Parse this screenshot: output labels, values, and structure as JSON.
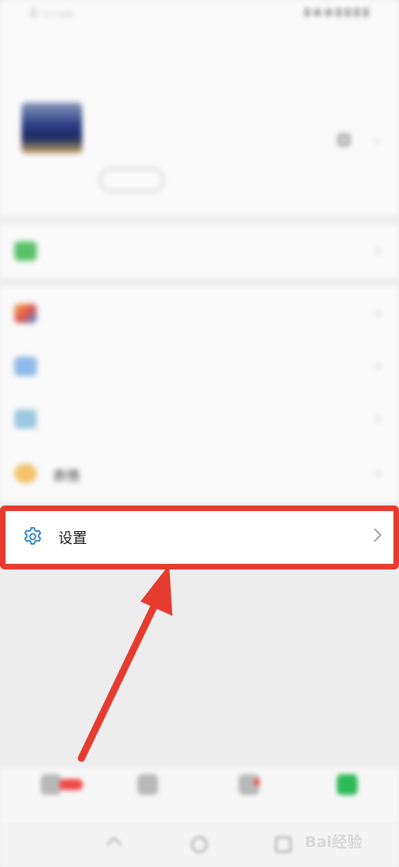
{
  "status_bar": {
    "left": "▯ ᵢ ᵤ ᵥ ᵨ ᵩ",
    "right": "▮ ◆ ◆ ▮ ▮ ▮ ▮"
  },
  "profile": {
    "name": "",
    "id_text": "",
    "status_label": ""
  },
  "menu": {
    "items": [
      {
        "label": "",
        "icon": "pay-icon",
        "color": "#59c06a"
      },
      {
        "label": "",
        "icon": "favorites-icon",
        "color": "#e9b34a"
      },
      {
        "label": "",
        "icon": "album-icon",
        "color": "#8fb9e8"
      },
      {
        "label": "",
        "icon": "cards-icon",
        "color": "#9cc7e0"
      },
      {
        "label": "表情",
        "icon": "sticker-icon",
        "color": "#f2c36b"
      }
    ],
    "settings": {
      "label": "设置",
      "icon": "gear-icon",
      "color": "#2b7ec7"
    }
  },
  "bottom_nav": [
    {
      "label": "",
      "icon": "chats-icon",
      "active": false
    },
    {
      "label": "",
      "icon": "contacts-icon",
      "active": false
    },
    {
      "label": "",
      "icon": "discover-icon",
      "active": false
    },
    {
      "label": "",
      "icon": "me-icon",
      "active": true
    }
  ],
  "annotation": {
    "highlight_color": "#e53c2f"
  },
  "watermark": "Bai经验"
}
